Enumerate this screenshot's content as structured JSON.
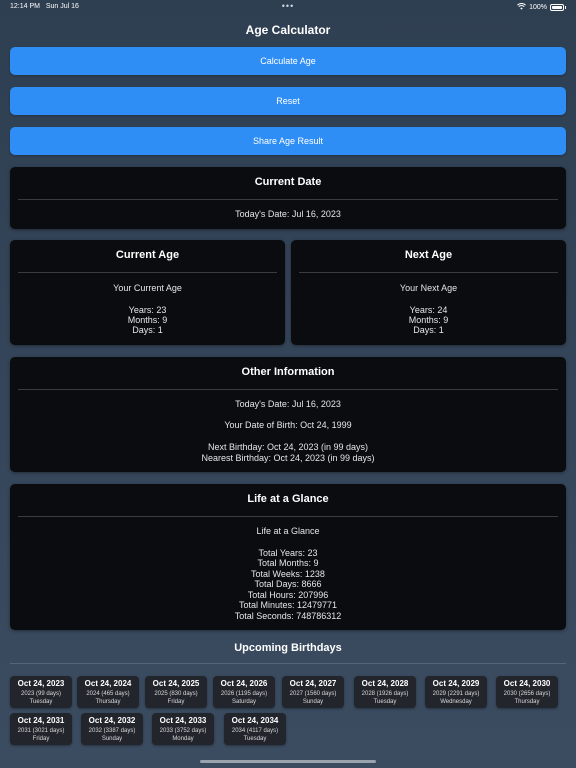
{
  "status_bar": {
    "time": "12:14 PM",
    "date": "Sun Jul 16",
    "dots": "•••",
    "battery": "100%"
  },
  "app_title": "Age Calculator",
  "buttons": {
    "calculate": "Calculate Age",
    "reset": "Reset",
    "share": "Share Age Result"
  },
  "current_date": {
    "title": "Current Date",
    "text": "Today's Date: Jul 16, 2023"
  },
  "current_age": {
    "title": "Current Age",
    "subtitle": "Your Current Age",
    "years": "Years: 23",
    "months": "Months: 9",
    "days": "Days: 1"
  },
  "next_age": {
    "title": "Next Age",
    "subtitle": "Your Next Age",
    "years": "Years: 24",
    "months": "Months: 9",
    "days": "Days: 1"
  },
  "other_info": {
    "title": "Other Information",
    "today": "Today's Date: Jul 16, 2023",
    "dob": "Your Date of Birth: Oct 24, 1999",
    "next_birthday": "Next Birthday: Oct 24, 2023 (in 99 days)",
    "nearest_birthday": "Nearest Birthday: Oct 24, 2023 (in 99 days)"
  },
  "life_glance": {
    "title": "Life at a Glance",
    "subtitle": "Life at a Glance",
    "years": "Total Years: 23",
    "months": "Total Months: 9",
    "weeks": "Total Weeks: 1238",
    "days": "Total Days: 8666",
    "hours": "Total Hours: 207996",
    "minutes": "Total Minutes: 12479771",
    "seconds": "Total Seconds: 748786312"
  },
  "upcoming": {
    "title": "Upcoming Birthdays",
    "items": [
      {
        "date": "Oct 24, 2023",
        "detail": "2023 (99 days)",
        "weekday": "Tuesday"
      },
      {
        "date": "Oct 24, 2024",
        "detail": "2024 (465 days)",
        "weekday": "Thursday"
      },
      {
        "date": "Oct 24, 2025",
        "detail": "2025 (830 days)",
        "weekday": "Friday"
      },
      {
        "date": "Oct 24, 2026",
        "detail": "2026 (1195 days)",
        "weekday": "Saturday"
      },
      {
        "date": "Oct 24, 2027",
        "detail": "2027 (1560 days)",
        "weekday": "Sunday"
      },
      {
        "date": "Oct 24, 2028",
        "detail": "2028 (1926 days)",
        "weekday": "Tuesday"
      },
      {
        "date": "Oct 24, 2029",
        "detail": "2029 (2291 days)",
        "weekday": "Wednesday"
      },
      {
        "date": "Oct 24, 2030",
        "detail": "2030 (2656 days)",
        "weekday": "Thursday"
      },
      {
        "date": "Oct 24, 2031",
        "detail": "2031 (3021 days)",
        "weekday": "Friday"
      },
      {
        "date": "Oct 24, 2032",
        "detail": "2032 (3387 days)",
        "weekday": "Sunday"
      },
      {
        "date": "Oct 24, 2033",
        "detail": "2033 (3752 days)",
        "weekday": "Monday"
      },
      {
        "date": "Oct 24, 2034",
        "detail": "2034 (4117 days)",
        "weekday": "Tuesday"
      }
    ]
  }
}
